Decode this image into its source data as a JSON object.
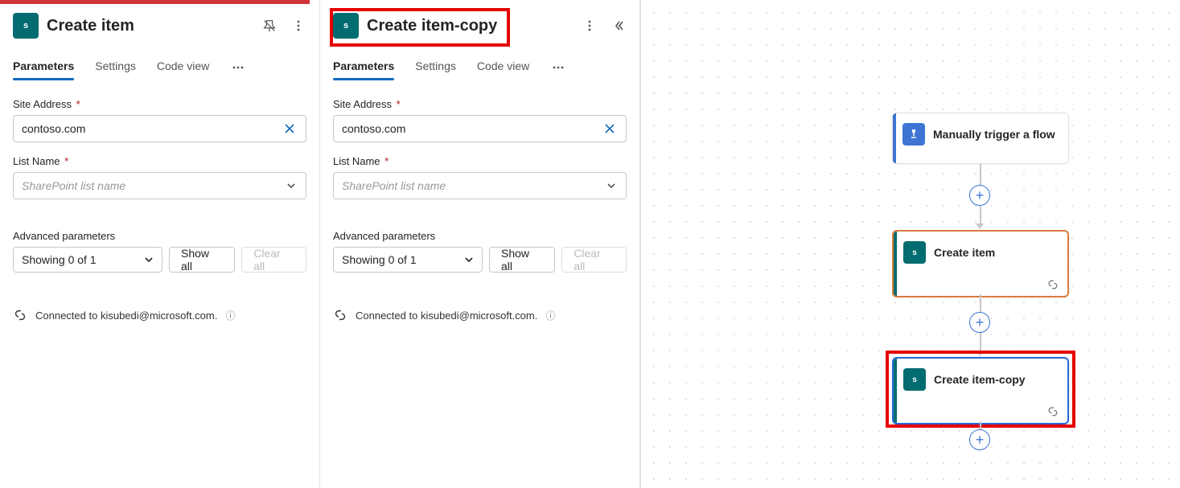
{
  "panel1": {
    "title": "Create item",
    "tabs": [
      "Parameters",
      "Settings",
      "Code view"
    ],
    "site_label": "Site Address",
    "site_value": "contoso.com",
    "list_label": "List Name",
    "list_placeholder": "SharePoint list name",
    "adv_label": "Advanced parameters",
    "adv_value": "Showing 0 of 1",
    "show_all": "Show all",
    "clear_all": "Clear all",
    "connected": "Connected to kisubedi@microsoft.com."
  },
  "panel2": {
    "title": "Create item-copy",
    "tabs": [
      "Parameters",
      "Settings",
      "Code view"
    ],
    "site_label": "Site Address",
    "site_value": "contoso.com",
    "list_label": "List Name",
    "list_placeholder": "SharePoint list name",
    "adv_label": "Advanced parameters",
    "adv_value": "Showing 0 of 1",
    "show_all": "Show all",
    "clear_all": "Clear all",
    "connected": "Connected to kisubedi@microsoft.com."
  },
  "canvas": {
    "trigger": "Manually trigger a flow",
    "action1": "Create item",
    "action2": "Create item-copy"
  }
}
